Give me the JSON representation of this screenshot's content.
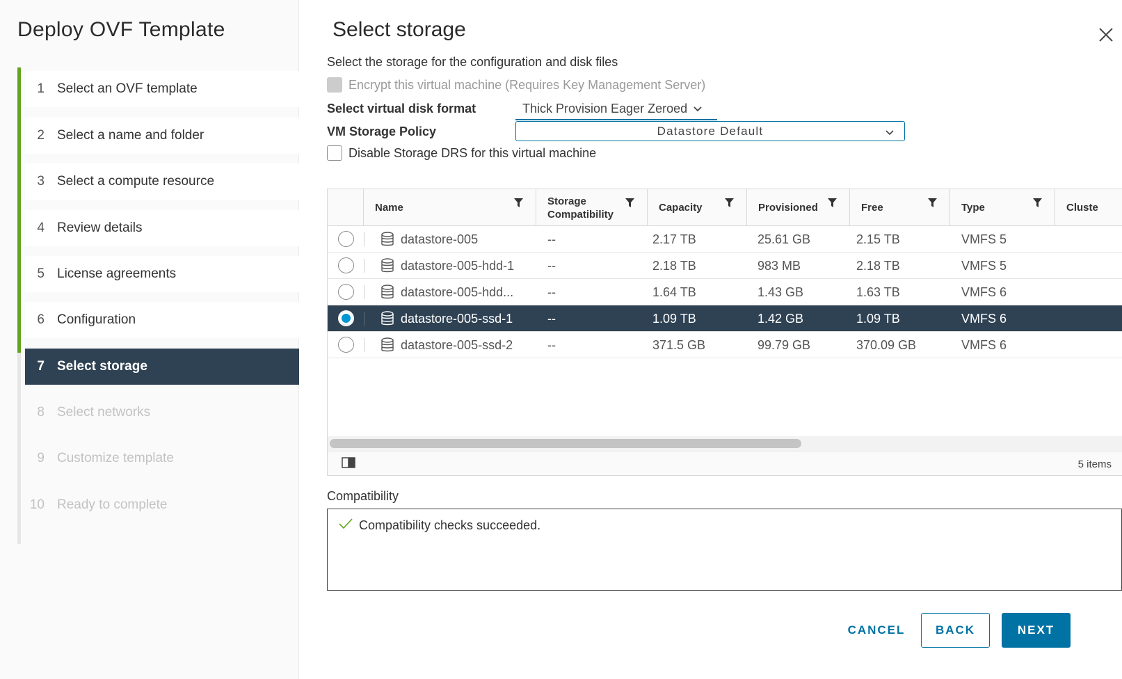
{
  "wizard": {
    "title": "Deploy OVF Template",
    "steps": [
      {
        "num": "1",
        "label": "Select an OVF template",
        "state": "done"
      },
      {
        "num": "2",
        "label": "Select a name and folder",
        "state": "done"
      },
      {
        "num": "3",
        "label": "Select a compute resource",
        "state": "done"
      },
      {
        "num": "4",
        "label": "Review details",
        "state": "done"
      },
      {
        "num": "5",
        "label": "License agreements",
        "state": "done"
      },
      {
        "num": "6",
        "label": "Configuration",
        "state": "done"
      },
      {
        "num": "7",
        "label": "Select storage",
        "state": "active"
      },
      {
        "num": "8",
        "label": "Select networks",
        "state": "disabled"
      },
      {
        "num": "9",
        "label": "Customize template",
        "state": "disabled"
      },
      {
        "num": "10",
        "label": "Ready to complete",
        "state": "disabled"
      }
    ]
  },
  "page": {
    "title": "Select storage",
    "subtitle": "Select the storage for the configuration and disk files",
    "encrypt_label": "Encrypt this virtual machine (Requires Key Management Server)",
    "disk_format_label": "Select virtual disk format",
    "disk_format_value": "Thick Provision Eager Zeroed",
    "policy_label": "VM Storage Policy",
    "policy_value": "Datastore Default",
    "drs_label": "Disable Storage DRS for this virtual machine"
  },
  "grid": {
    "columns": [
      "Name",
      "Storage Compatibility",
      "Capacity",
      "Provisioned",
      "Free",
      "Type",
      "Cluste"
    ],
    "rows": [
      {
        "name": "datastore-005",
        "compat": "--",
        "capacity": "2.17 TB",
        "provisioned": "25.61 GB",
        "free": "2.15 TB",
        "type": "VMFS 5",
        "selected": false
      },
      {
        "name": "datastore-005-hdd-1",
        "compat": "--",
        "capacity": "2.18 TB",
        "provisioned": "983 MB",
        "free": "2.18 TB",
        "type": "VMFS 5",
        "selected": false
      },
      {
        "name": "datastore-005-hdd...",
        "compat": "--",
        "capacity": "1.64 TB",
        "provisioned": "1.43 GB",
        "free": "1.63 TB",
        "type": "VMFS 6",
        "selected": false
      },
      {
        "name": "datastore-005-ssd-1",
        "compat": "--",
        "capacity": "1.09 TB",
        "provisioned": "1.42 GB",
        "free": "1.09 TB",
        "type": "VMFS 6",
        "selected": true
      },
      {
        "name": "datastore-005-ssd-2",
        "compat": "--",
        "capacity": "371.5 GB",
        "provisioned": "99.79 GB",
        "free": "370.09 GB",
        "type": "VMFS 6",
        "selected": false
      }
    ],
    "items_count": "5 items"
  },
  "compatibility": {
    "label": "Compatibility",
    "message": "Compatibility checks succeeded."
  },
  "buttons": {
    "cancel": "CANCEL",
    "back": "BACK",
    "next": "NEXT"
  },
  "colors": {
    "accent": "#0072a3",
    "selected_row": "#2f4254",
    "done_bar": "#62a420"
  }
}
